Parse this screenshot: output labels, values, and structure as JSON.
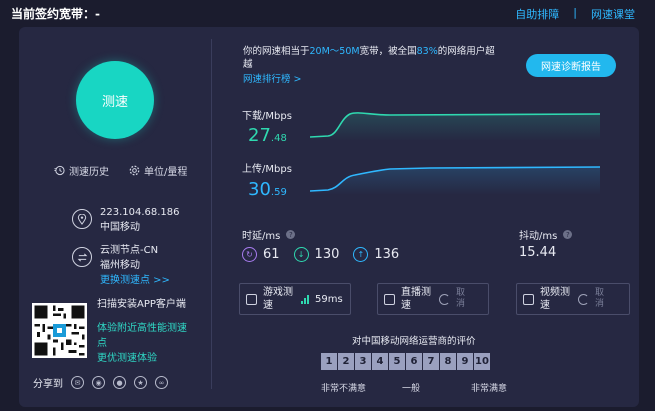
{
  "header": {
    "title": "当前签约宽带：-",
    "links": [
      "自助排障",
      "网速课堂"
    ],
    "separator": "|"
  },
  "left": {
    "speed_button": "测速",
    "history_link": "测速历史",
    "unit_link": "单位/量程",
    "ip": "223.104.68.186",
    "isp": "中国移动",
    "node_name": "云测节点-CN",
    "node_location": "福州移动",
    "change_node": "更换测速点 >>",
    "app_title": "扫描安装APP客户端",
    "app_desc_1": "体验附近高性能测速",
    "app_desc_2": "点",
    "app_desc_3": "更优测速体验",
    "share_label": "分享到",
    "share_icons": [
      "wechat-icon",
      "weibo-icon",
      "qq-icon",
      "qzone-icon",
      "link-icon"
    ]
  },
  "summary": {
    "prefix": "你的网速相当于",
    "range": "20M～50M",
    "mid": "宽带，被全国",
    "percent": "83%",
    "suffix": "的网络用户超越",
    "rank_link": "网速排行榜 >"
  },
  "diag_button": "网速诊断报告",
  "download": {
    "label": "下载/Mbps",
    "int": "27",
    "dec": ".48"
  },
  "upload": {
    "label": "上传/Mbps",
    "int": "30",
    "dec": ".59"
  },
  "latency": {
    "label": "时延/ms",
    "values": [
      "61",
      "130",
      "136"
    ]
  },
  "jitter": {
    "label": "抖动/ms",
    "value": "15.44"
  },
  "apps": [
    {
      "label": "游戏测速",
      "value": "59ms"
    },
    {
      "label": "直播测速",
      "value": "取消"
    },
    {
      "label": "视频测速",
      "value": "取消"
    }
  ],
  "evaluation": {
    "title": "对中国移动网络运营商的评价",
    "scores": [
      "1",
      "2",
      "3",
      "4",
      "5",
      "6",
      "7",
      "8",
      "9",
      "10"
    ],
    "low": "非常不满意",
    "mid": "一般",
    "high": "非常满意"
  },
  "colors": {
    "background": "#1b1c2e",
    "panel": "#262842",
    "accent_teal": "#18d6c3",
    "accent_blue": "#2fb8ff"
  }
}
